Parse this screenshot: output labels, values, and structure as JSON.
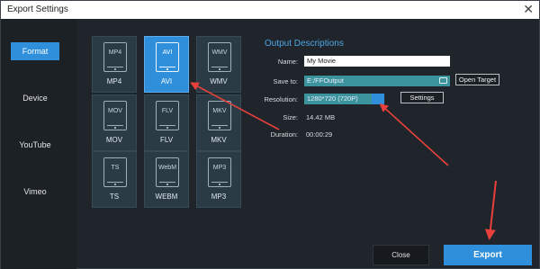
{
  "window": {
    "title": "Export Settings",
    "close_glyph": "✕"
  },
  "sidebar": {
    "items": [
      {
        "label": "Format",
        "active": true
      },
      {
        "label": "Device",
        "active": false
      },
      {
        "label": "YouTube",
        "active": false
      },
      {
        "label": "Vimeo",
        "active": false
      }
    ]
  },
  "formats": [
    {
      "ext": "MP4",
      "label": "MP4",
      "selected": false
    },
    {
      "ext": "AVI",
      "label": "AVI",
      "selected": true
    },
    {
      "ext": "WMV",
      "label": "WMV",
      "selected": false
    },
    {
      "ext": "MOV",
      "label": "MOV",
      "selected": false
    },
    {
      "ext": "FLV",
      "label": "FLV",
      "selected": false
    },
    {
      "ext": "MKV",
      "label": "MKV",
      "selected": false
    },
    {
      "ext": "TS",
      "label": "TS",
      "selected": false
    },
    {
      "ext": "WebM",
      "label": "WEBM",
      "selected": false
    },
    {
      "ext": "MP3",
      "label": "MP3",
      "selected": false
    }
  ],
  "output": {
    "title": "Output Descriptions",
    "name_label": "Name:",
    "name_value": "My Movie",
    "save_label": "Save to:",
    "save_value": "E:/FFOutput",
    "open_target": "Open Target",
    "resolution_label": "Resolution:",
    "resolution_value": "1280*720 (720P)",
    "settings": "Settings",
    "size_label": "Size:",
    "size_value": "14.42 MB",
    "duration_label": "Duration:",
    "duration_value": "00:00:29"
  },
  "footer": {
    "close": "Close",
    "export": "Export"
  },
  "colors": {
    "accent": "#2f8fdb",
    "annotation": "#e8413c"
  }
}
